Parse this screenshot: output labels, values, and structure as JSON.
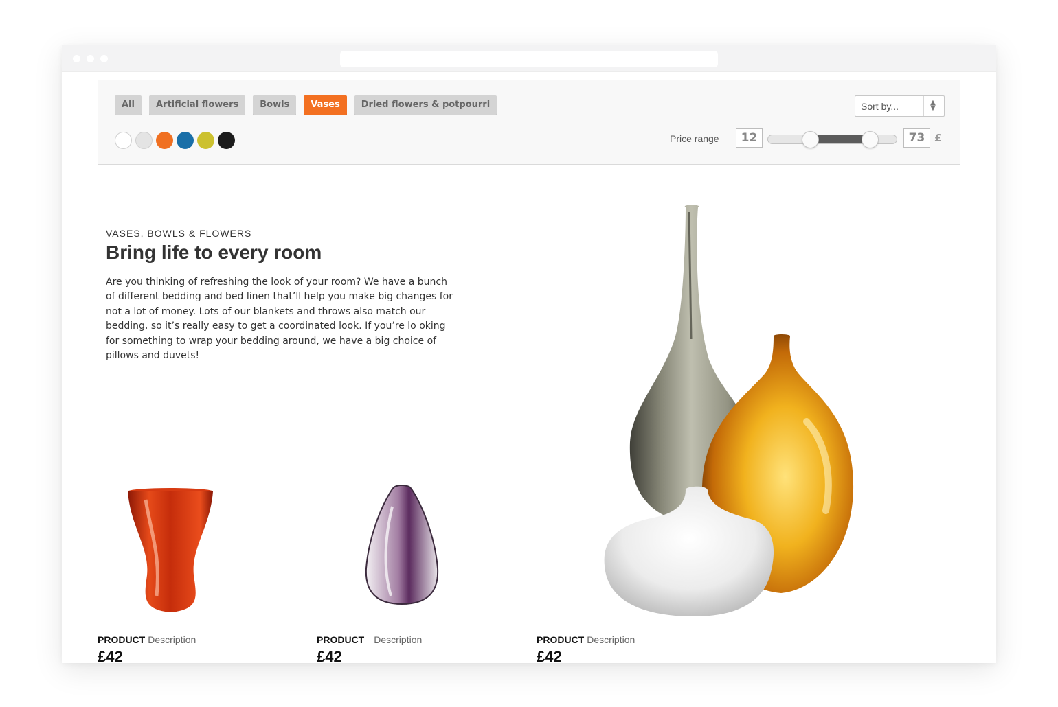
{
  "filters": {
    "categories": [
      {
        "label": "All",
        "active": false
      },
      {
        "label": "Artificial flowers",
        "active": false
      },
      {
        "label": "Bowls",
        "active": false
      },
      {
        "label": "Vases",
        "active": true
      },
      {
        "label": "Dried flowers & potpourri",
        "active": false
      }
    ],
    "colors": [
      "#ffffff",
      "#e4e4e4",
      "#f07021",
      "#1a6fa8",
      "#ccc12f",
      "#1c1c1c"
    ],
    "sort": {
      "label": "Sort by..."
    },
    "price": {
      "label": "Price range",
      "min": "12",
      "max": "73",
      "currency": "£",
      "min_fraction": 0.33,
      "max_fraction": 0.79
    }
  },
  "hero": {
    "eyebrow": "VASES, BOWLS & FLOWERS",
    "title": "Bring life to every room",
    "body": "Are you thinking of refreshing the look of your room? We have a bunch of different bedding and bed linen that’ll help you make big changes for not a lot of money. Lots of our blankets and throws also match our bedding, so it’s really easy to get a coordinated look. If you’re lo oking for something to wrap your bedding around, we have a big choice of pillows and duvets!"
  },
  "products": [
    {
      "name": "PRODUCT",
      "description": "Description",
      "price": "£42"
    },
    {
      "name": "PRODUCT",
      "description": "Description",
      "price": "£42"
    },
    {
      "name": "PRODUCT",
      "description": "Description",
      "price": "£42"
    }
  ],
  "icons": {
    "sort_arrows": "sort-arrows-icon"
  }
}
